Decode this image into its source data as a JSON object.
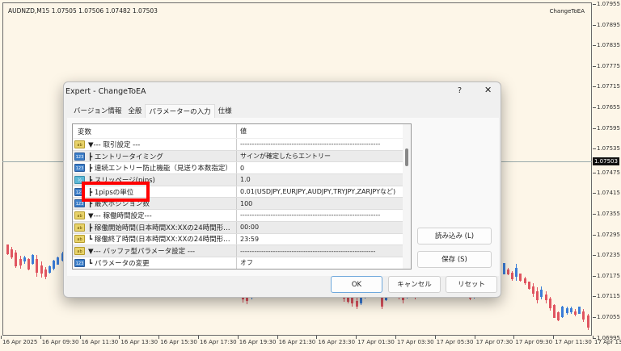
{
  "chart": {
    "symbol_line": "AUDNZD,M15  1.07505 1.07506 1.07482 1.07503",
    "ea_label": "ChangeToEA",
    "current_price": "1.07503",
    "price_ticks": [
      "1.07955",
      "1.07895",
      "1.07835",
      "1.07775",
      "1.07715",
      "1.07655",
      "1.07595",
      "1.07535",
      "1.07475",
      "1.07415",
      "1.07355",
      "1.07295",
      "1.07235",
      "1.07175",
      "1.07115",
      "1.07055",
      "1.06995"
    ],
    "time_ticks": [
      "16 Apr 2025",
      "16 Apr 09:30",
      "16 Apr 11:30",
      "16 Apr 13:30",
      "16 Apr 15:30",
      "16 Apr 17:30",
      "16 Apr 19:30",
      "16 Apr 21:30",
      "16 Apr 23:30",
      "17 Apr 01:30",
      "17 Apr 03:30",
      "17 Apr 05:30",
      "17 Apr 07:30",
      "17 Apr 09:30",
      "17 Apr 11:30",
      "17 Apr 13:30"
    ],
    "colors": {
      "bull": "#3b7dd8",
      "bear": "#e05560"
    }
  },
  "dialog": {
    "title": "Expert - ChangeToEA",
    "help": "?",
    "close": "✕",
    "tabs": [
      "バージョン情報",
      "全般",
      "パラメーターの入力",
      "仕様"
    ],
    "active_tab": 2,
    "columns": [
      "変数",
      "値"
    ],
    "rows": [
      {
        "type": "ab",
        "name": "▼--- 取引設定 ---",
        "value": "------------------------------------------------------------"
      },
      {
        "type": "int",
        "name": "┣ エントリータイミング",
        "value": "サインが確定したらエントリー"
      },
      {
        "type": "int",
        "name": "┣ 連続エントリー防止機能（見送り本数指定）",
        "value": "0"
      },
      {
        "type": "dbl",
        "name": "┣ スリッページ(pips)",
        "value": "1.0"
      },
      {
        "type": "int",
        "name": "┣ 1pipsの単位",
        "value": "0.01(USDJPY,EURJPY,AUDJPY,TRYJPY,ZARJPYなど)"
      },
      {
        "type": "int",
        "name": "┣ 最大ポジション数",
        "value": "100"
      },
      {
        "type": "ab",
        "name": "▼--- 稼働時間設定---",
        "value": "------------------------------------------------------------"
      },
      {
        "type": "ab",
        "name": "┣ 稼働開始時間(日本時間XX:XXの24時間形…",
        "value": "00:00"
      },
      {
        "type": "ab",
        "name": "┗ 稼働終了時間(日本時間XX:XXの24時間形…",
        "value": "23:59"
      },
      {
        "type": "ab",
        "name": "▼--- バッファ型パラメータ設定 ---",
        "value": "----------------------------------------------------------"
      },
      {
        "type": "int",
        "name": "┗ パラメータの変更",
        "value": "オフ"
      }
    ],
    "icon_labels": {
      "ab": "ab",
      "int": "123",
      "dbl": "½"
    },
    "load_button": "読み込み (L)",
    "save_button": "保存 (S)",
    "ok_button": "OK",
    "cancel_button": "キャンセル",
    "reset_button": "リセット",
    "highlight_color": "#ff0000"
  }
}
